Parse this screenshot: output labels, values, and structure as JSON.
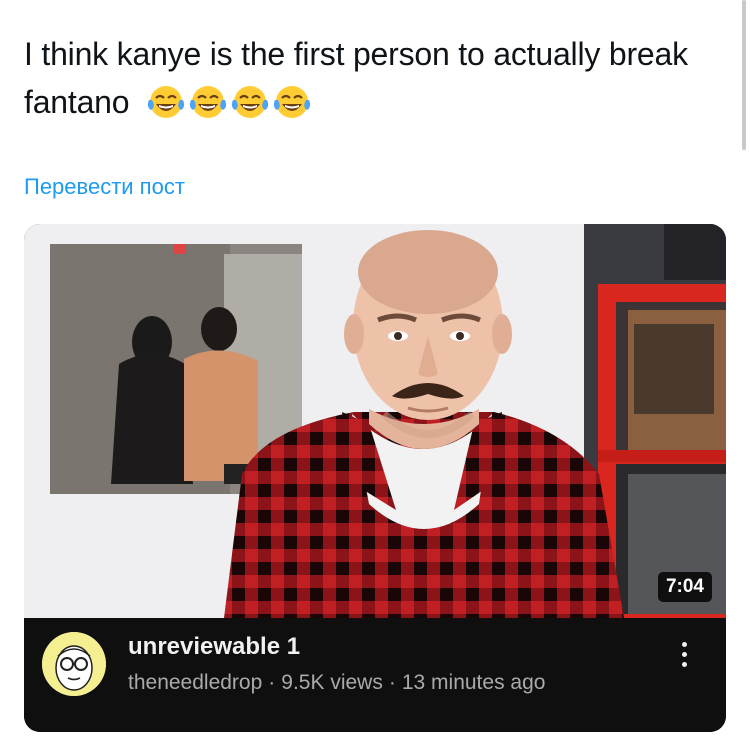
{
  "post": {
    "text": "I think kanye is the first person to actually break fantano",
    "emojis": [
      "face-with-tears-of-joy-icon",
      "face-with-tears-of-joy-icon",
      "face-with-tears-of-joy-icon",
      "face-with-tears-of-joy-icon"
    ],
    "translate_label": "Перевести пост"
  },
  "video": {
    "duration": "7:04",
    "title": "unreviewable 1",
    "channel": "theneedledrop",
    "separator": "·",
    "views": "9.5K views",
    "posted": "13 minutes ago",
    "more_icon": "more-vertical-icon"
  },
  "colors": {
    "link": "#1d9bf0",
    "text": "#0f1419",
    "card_bg": "#0f0f0f",
    "shelf_red": "#d9261f",
    "shirt_red": "#b8181c"
  }
}
